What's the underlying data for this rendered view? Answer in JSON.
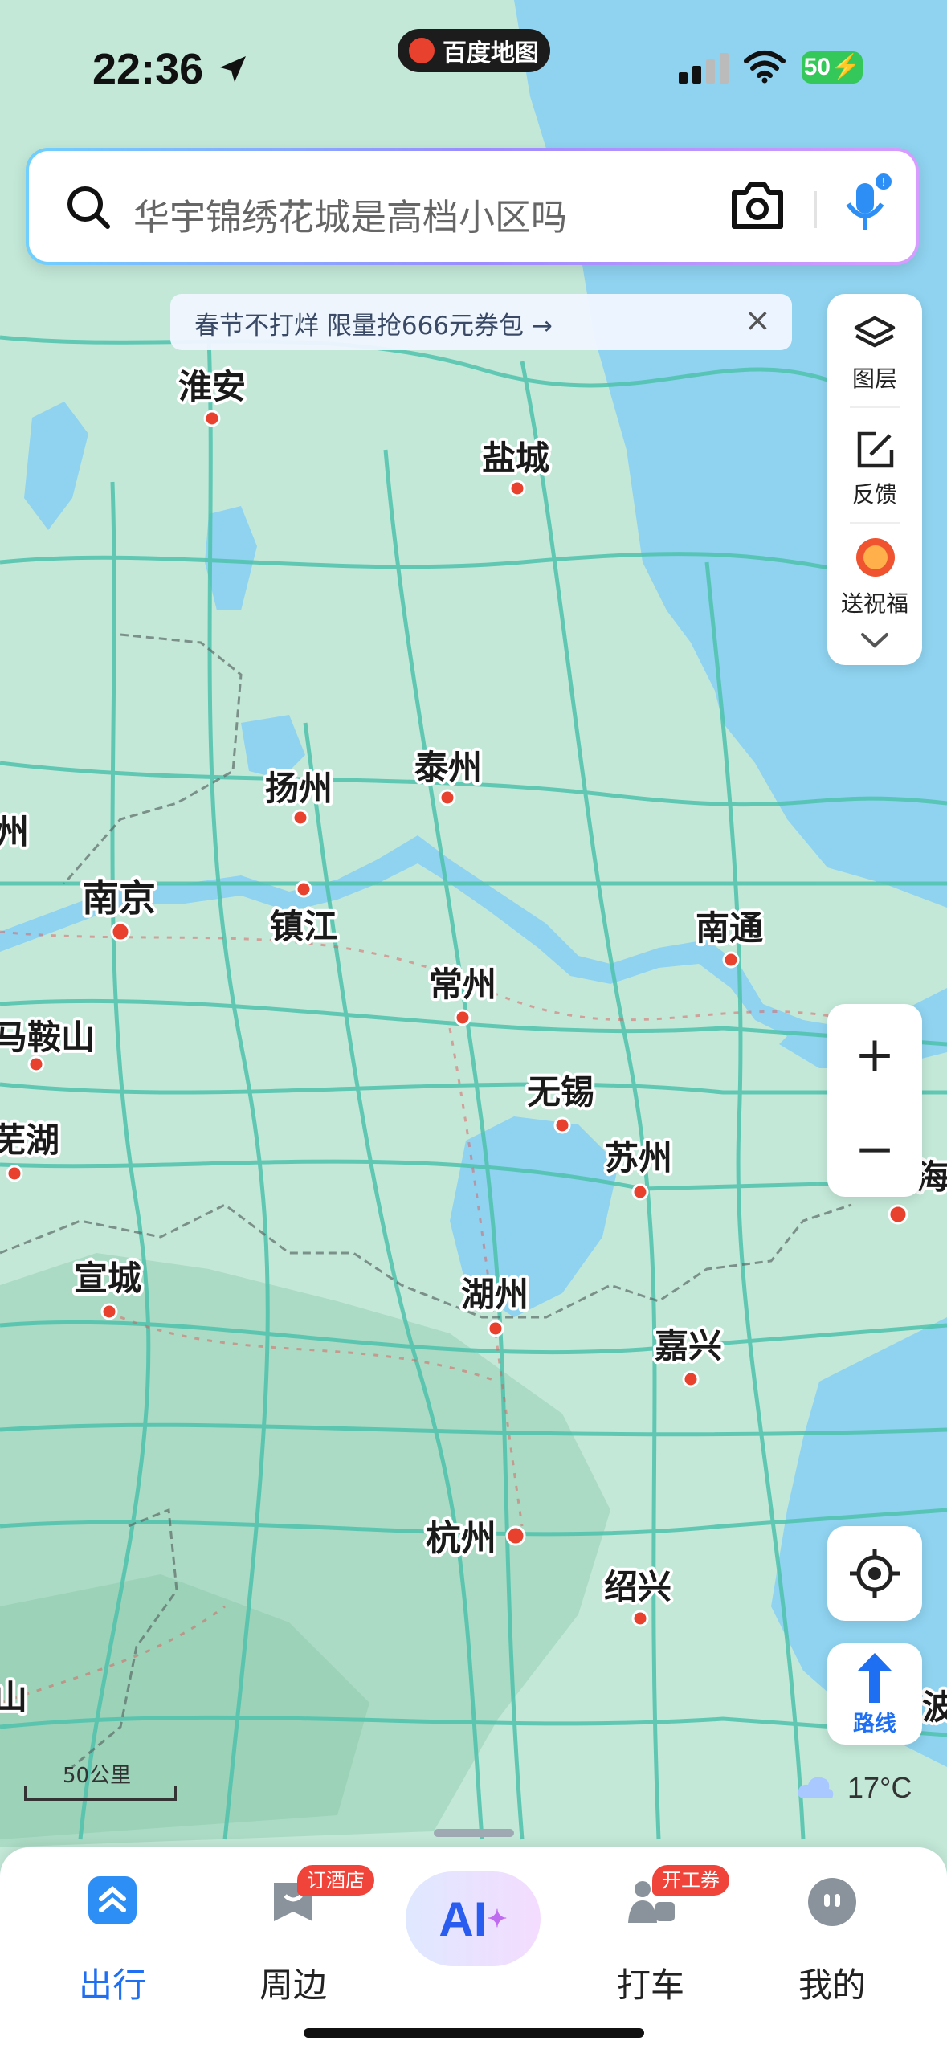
{
  "status_bar": {
    "time": "22:36",
    "battery": "50",
    "app_name": "百度地图"
  },
  "search": {
    "placeholder": "华宇锦绣花城是高档小区吗"
  },
  "banner": {
    "text": "春节不打烊 限量抢666元券包 →",
    "close": "×"
  },
  "right_panel": {
    "layers": "图层",
    "feedback": "反馈",
    "greeting": "送祝福"
  },
  "zoom": {
    "in": "+",
    "out": "−"
  },
  "route_label": "路线",
  "weather": "17°C",
  "scale_label": "50公里",
  "cities": [
    {
      "name": "淮安"
    },
    {
      "name": "盐城"
    },
    {
      "name": "扬州"
    },
    {
      "name": "泰州"
    },
    {
      "name": "南京"
    },
    {
      "name": "镇江"
    },
    {
      "name": "南通"
    },
    {
      "name": "常州"
    },
    {
      "name": "马鞍山"
    },
    {
      "name": "无锡"
    },
    {
      "name": "芜湖"
    },
    {
      "name": "苏州"
    },
    {
      "name": "宣城"
    },
    {
      "name": "湖州"
    },
    {
      "name": "嘉兴"
    },
    {
      "name": "杭州"
    },
    {
      "name": "绍兴"
    },
    {
      "name": "海"
    },
    {
      "name": "波"
    },
    {
      "name": "州"
    },
    {
      "name": "山"
    }
  ],
  "tabs": [
    {
      "label": "出行"
    },
    {
      "label": "周边",
      "badge": "订酒店"
    },
    {
      "label": "AI"
    },
    {
      "label": "打车",
      "badge": "开工券"
    },
    {
      "label": "我的"
    }
  ],
  "colors": {
    "accent": "#1f6ff2",
    "badge": "#f0443a",
    "sea": "#8fd3f0",
    "land": "#bfe6d6",
    "road": "#4fc2ad"
  }
}
